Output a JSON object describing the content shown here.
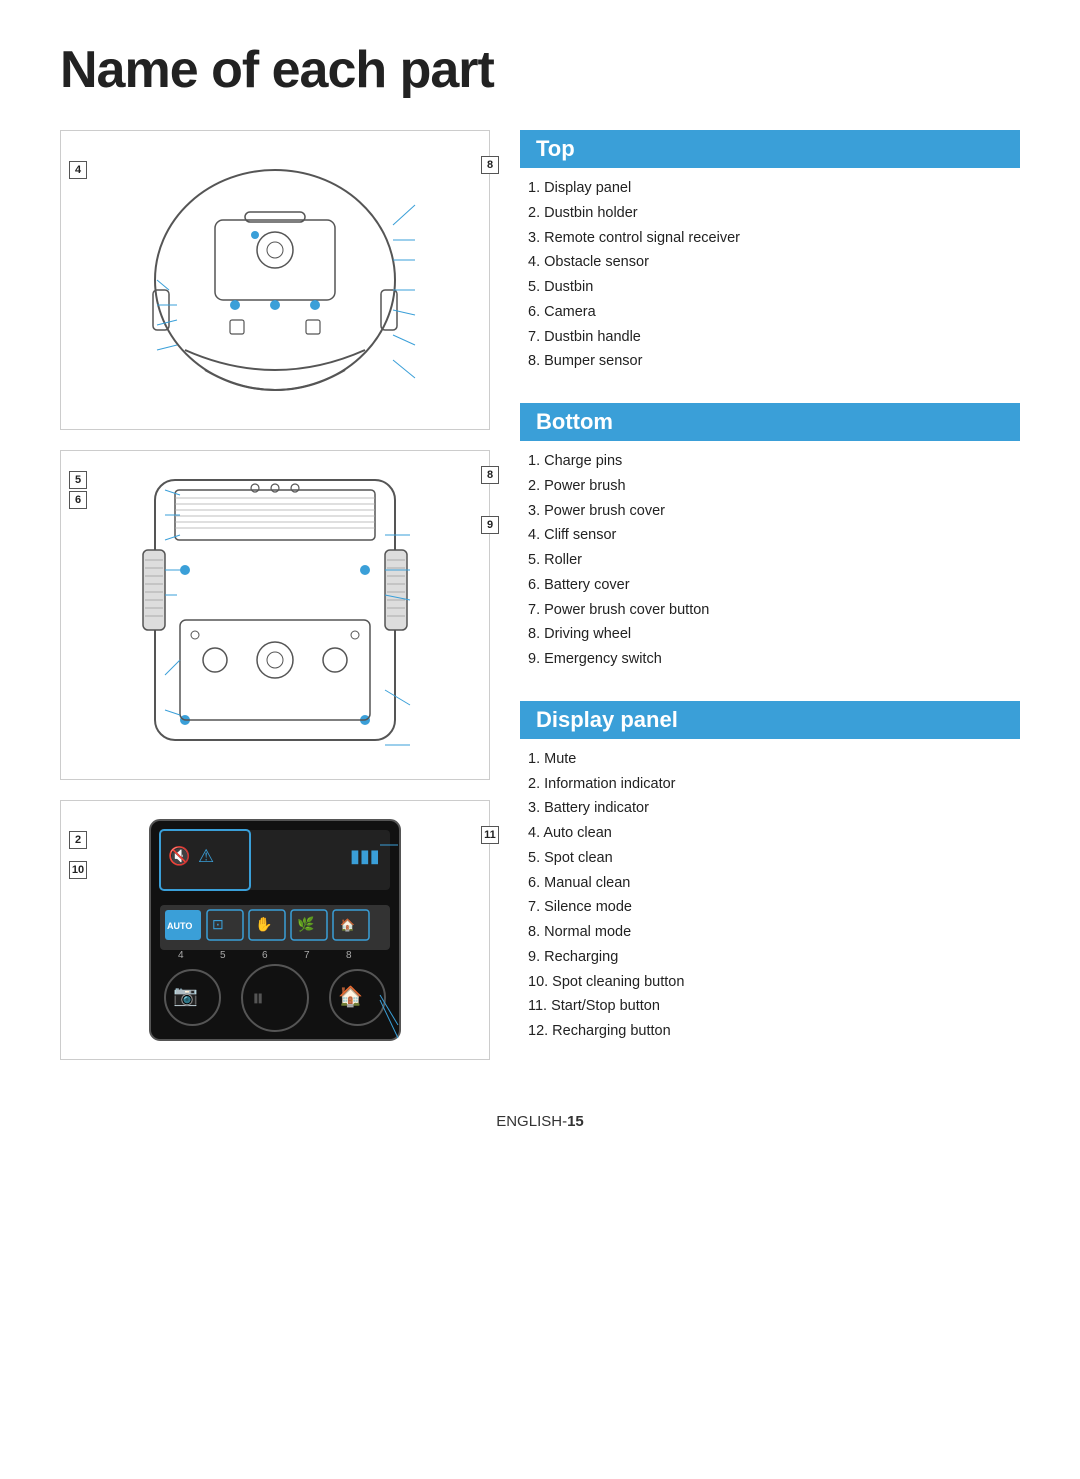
{
  "page": {
    "title": "Name of each part",
    "footer": "ENGLISH-",
    "footer_num": "15"
  },
  "top_section": {
    "header": "Top",
    "items": [
      "Display panel",
      "Dustbin holder",
      "Remote control signal receiver",
      "Obstacle sensor",
      "Dustbin",
      "Camera",
      "Dustbin handle",
      "Bumper sensor"
    ]
  },
  "bottom_section": {
    "header": "Bottom",
    "items": [
      "Charge pins",
      "Power brush",
      "Power brush cover",
      "Cliff sensor",
      "Roller",
      "Battery cover",
      "Power brush cover button",
      "Driving wheel",
      "Emergency switch"
    ]
  },
  "display_section": {
    "header": "Display panel",
    "items": [
      "Mute",
      "Information indicator",
      "Battery indicator",
      "Auto clean",
      "Spot clean",
      "Manual clean",
      "Silence mode",
      "Normal mode",
      "Recharging",
      "Spot cleaning button",
      "Start/Stop button",
      "Recharging button"
    ]
  }
}
